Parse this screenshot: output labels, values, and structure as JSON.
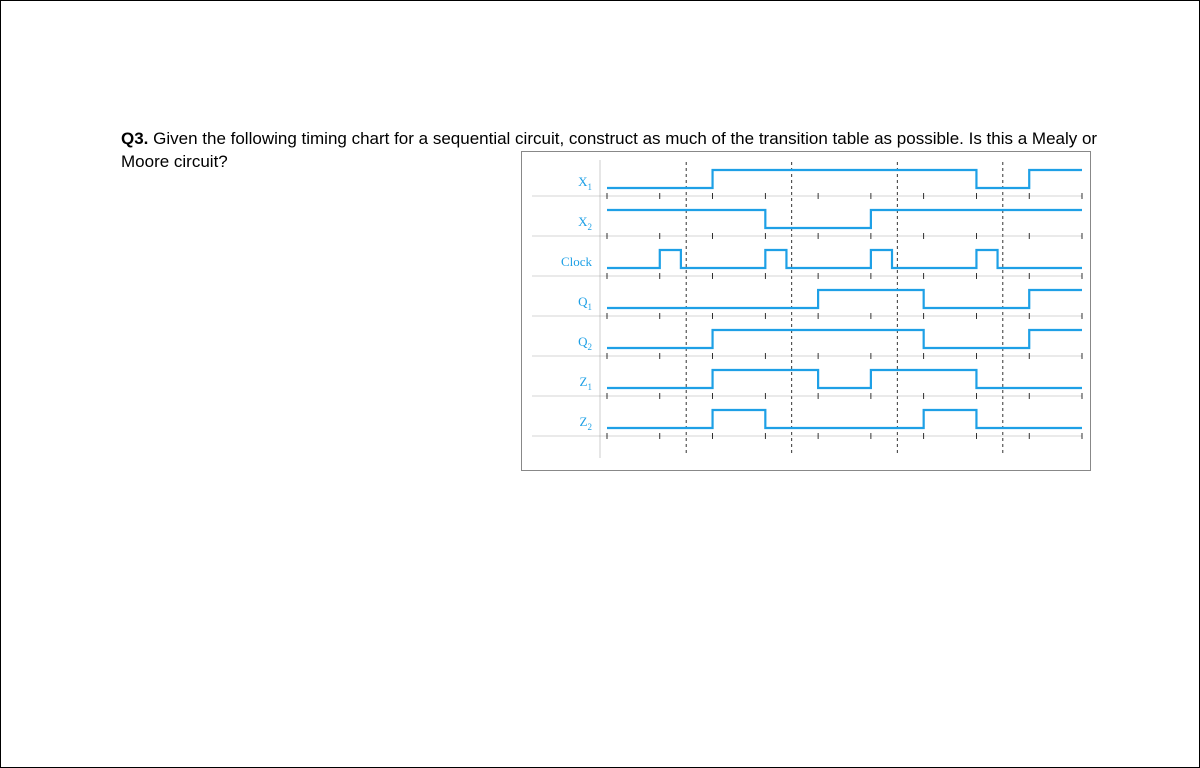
{
  "question": {
    "number": "Q3.",
    "text": "Given the following timing chart for a sequential circuit, construct as much of the transition table as possible. Is this a Mealy or Moore circuit?"
  },
  "chart_data": {
    "type": "timing-diagram",
    "time_steps": 9,
    "clock_edge_positions": [
      1.5,
      3.5,
      5.5,
      7.5
    ],
    "signals": [
      {
        "name": "X1",
        "label": "X",
        "sub": "1",
        "values": [
          0,
          0,
          1,
          1,
          1,
          1,
          1,
          0,
          1
        ]
      },
      {
        "name": "X2",
        "label": "X",
        "sub": "2",
        "values": [
          1,
          1,
          1,
          0,
          0,
          1,
          1,
          1,
          1
        ]
      },
      {
        "name": "Clock",
        "label": "Clock",
        "sub": "",
        "pulses_at": [
          1,
          3,
          5,
          7
        ],
        "pulse_width": 0.4
      },
      {
        "name": "Q1",
        "label": "Q",
        "sub": "1",
        "values": [
          0,
          0,
          0,
          0,
          1,
          1,
          0,
          0,
          1
        ]
      },
      {
        "name": "Q2",
        "label": "Q",
        "sub": "2",
        "values": [
          0,
          0,
          1,
          1,
          1,
          1,
          0,
          0,
          1
        ]
      },
      {
        "name": "Z1",
        "label": "Z",
        "sub": "1",
        "values": [
          0,
          0,
          1,
          1,
          0,
          1,
          1,
          0,
          0
        ]
      },
      {
        "name": "Z2",
        "label": "Z",
        "sub": "2",
        "values": [
          0,
          0,
          1,
          0,
          0,
          0,
          1,
          0,
          0
        ]
      }
    ]
  }
}
